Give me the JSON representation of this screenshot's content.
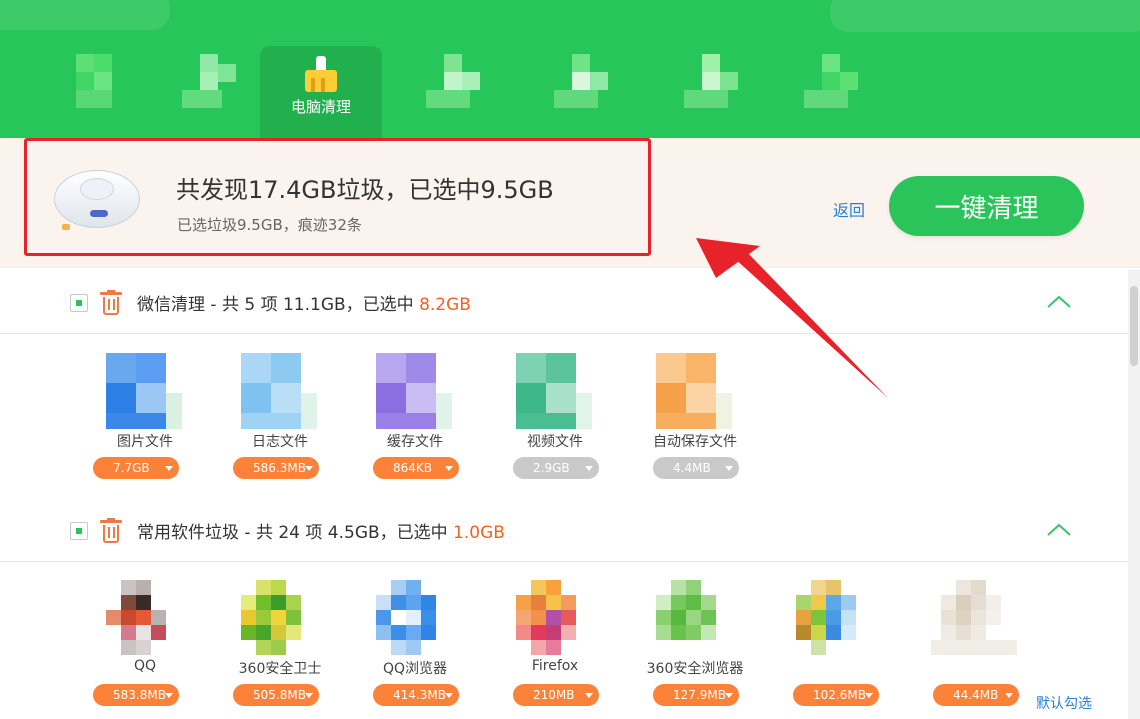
{
  "header": {
    "active_tab_label": "电脑清理",
    "colors": {
      "bg": "#27c65a",
      "active": "#22b04f"
    }
  },
  "summary": {
    "title": "共发现17.4GB垃圾，已选中9.5GB",
    "subtitle": "已选垃圾9.5GB，痕迹32条",
    "back_label": "返回",
    "clean_button_label": "一键清理"
  },
  "sections": [
    {
      "title_main": "微信清理 - 共 5 项 11.1GB，已选中 ",
      "title_highlight": "8.2GB",
      "items": [
        {
          "name": "图片文件",
          "size": "7.7GB",
          "state": "selected",
          "icon": "image-file-icon"
        },
        {
          "name": "日志文件",
          "size": "586.3MB",
          "state": "selected",
          "icon": "log-file-icon"
        },
        {
          "name": "缓存文件",
          "size": "864KB",
          "state": "selected",
          "icon": "cache-file-icon"
        },
        {
          "name": "视频文件",
          "size": "2.9GB",
          "state": "unselected",
          "icon": "video-file-icon"
        },
        {
          "name": "自动保存文件",
          "size": "4.4MB",
          "state": "unselected",
          "icon": "autosave-file-icon"
        }
      ]
    },
    {
      "title_main": "常用软件垃圾 - 共 24 项 4.5GB，已选中 ",
      "title_highlight": "1.0GB",
      "items": [
        {
          "name": "QQ",
          "size": "583.8MB",
          "state": "selected",
          "icon": "qq-icon"
        },
        {
          "name": "360安全卫士",
          "size": "505.8MB",
          "state": "selected",
          "icon": "360-safe-icon"
        },
        {
          "name": "QQ浏览器",
          "size": "414.3MB",
          "state": "selected",
          "icon": "qq-browser-icon"
        },
        {
          "name": "Firefox",
          "size": "210MB",
          "state": "selected",
          "icon": "firefox-icon"
        },
        {
          "name": "360安全浏览器",
          "size": "127.9MB",
          "state": "selected",
          "icon": "360-browser-icon"
        },
        {
          "name": "",
          "size": "102.6MB",
          "state": "selected",
          "icon": "tencent-video-icon"
        },
        {
          "name": "",
          "size": "44.4MB",
          "state": "selected",
          "icon": "blurred-app-icon"
        }
      ]
    }
  ],
  "footer": {
    "default_select_label": "默认勾选"
  },
  "annotation": {
    "color": "#e8222a"
  }
}
